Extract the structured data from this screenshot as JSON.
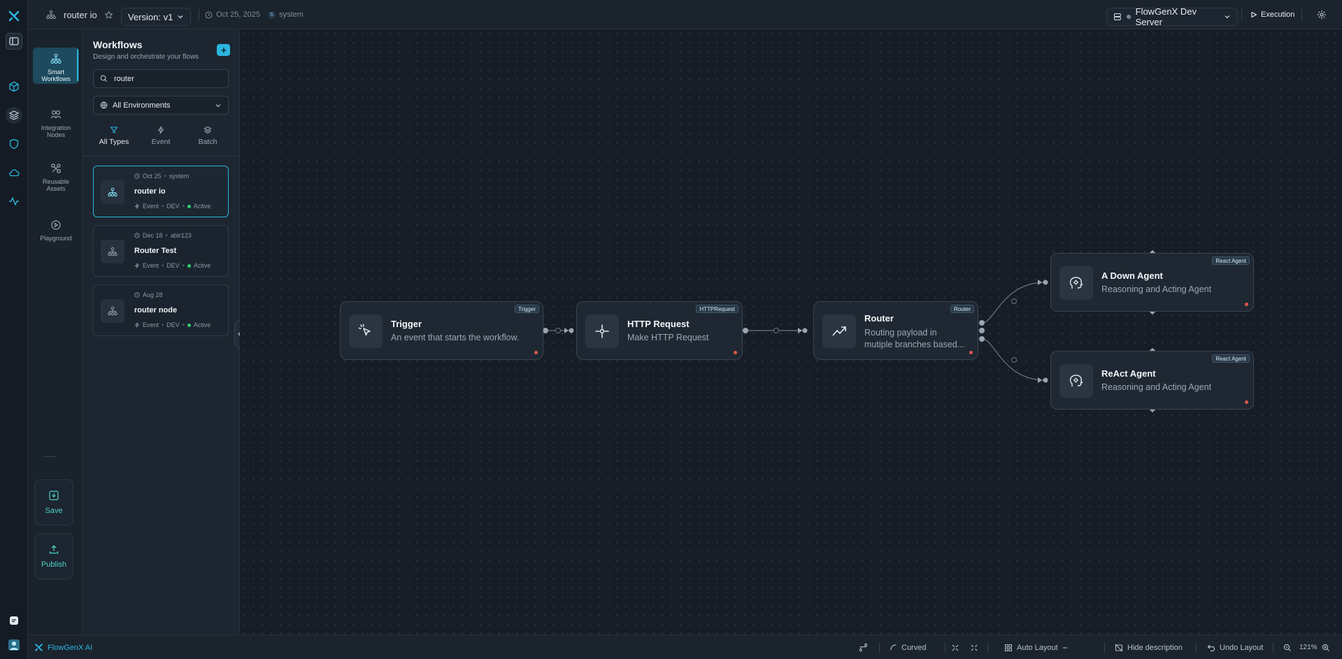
{
  "topbar": {
    "workflow_name": "router io",
    "version_label": "Version: v1",
    "date": "Oct 25, 2025",
    "user_initial": "S",
    "user": "system",
    "server": "FlowGenX Dev Server",
    "execution_label": "Execution"
  },
  "leftnav": {
    "items": [
      {
        "label_1": "Smart",
        "label_2": "Workflows",
        "icon": "workflow-icon"
      },
      {
        "label_1": "Integration",
        "label_2": "Nodes",
        "icon": "integration-icon"
      },
      {
        "label_1": "Reusable",
        "label_2": "Assets",
        "icon": "assets-icon"
      },
      {
        "label_1": "Playground",
        "label_2": "",
        "icon": "play-icon"
      }
    ],
    "save_label": "Save",
    "publish_label": "Publish"
  },
  "panel": {
    "title": "Workflows",
    "subtitle": "Design and orchestrate your flows",
    "search_value": "router",
    "environment": "All Environments",
    "filters": [
      "All Types",
      "Event",
      "Batch"
    ],
    "workflows": [
      {
        "date": "Oct 25",
        "owner": "system",
        "title": "router io",
        "type": "Event",
        "env": "DEV",
        "status": "Active"
      },
      {
        "date": "Dec 18",
        "owner": "abir123",
        "title": "Router Test",
        "type": "Event",
        "env": "DEV",
        "status": "Active"
      },
      {
        "date": "Aug 28",
        "owner": "",
        "title": "router node",
        "type": "Event",
        "env": "DEV",
        "status": "Active"
      }
    ]
  },
  "nodes": {
    "trigger": {
      "title": "Trigger",
      "desc": "An event that starts the workflow.",
      "badge": "Trigger"
    },
    "http": {
      "title": "HTTP Request",
      "desc": "Make HTTP Request",
      "badge": "HTTPRequest"
    },
    "router": {
      "title": "Router",
      "desc_1": "Routing payload in",
      "desc_2": "mutiple branches based...",
      "badge": "Router"
    },
    "agent1": {
      "title": "A Down Agent",
      "desc": "Reasoning and Acting Agent",
      "badge": "React Agent"
    },
    "agent2": {
      "title": "ReAct Agent",
      "desc": "Reasoning and Acting Agent",
      "badge": "React Agent"
    }
  },
  "bottombar": {
    "brand": "FlowGenX AI",
    "curved": "Curved",
    "auto_layout": "Auto Layout",
    "hide_description": "Hide description",
    "undo_layout": "Undo Layout",
    "zoom": "121%"
  },
  "colors": {
    "accent": "#2bb6e0",
    "green": "#4fd1c5",
    "status_active": "#2ecc71",
    "error_dot": "#e0574c"
  }
}
